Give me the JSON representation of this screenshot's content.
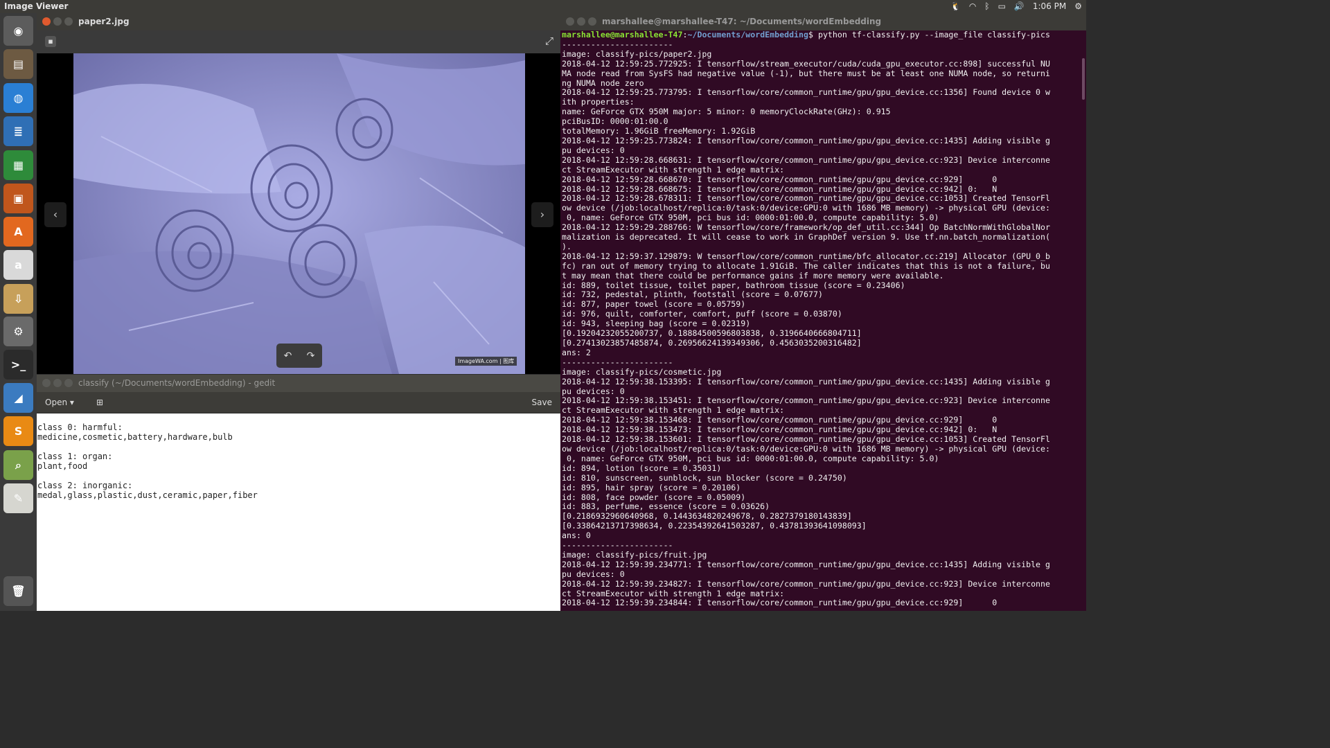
{
  "topbar": {
    "title": "Image Viewer",
    "clock": "1:06 PM"
  },
  "launcher": {
    "items": [
      {
        "name": "ubuntu-dash-icon",
        "glyph": "◉",
        "bg": "#5c5c5c"
      },
      {
        "name": "files-icon",
        "glyph": "▤",
        "bg": "#6d5a42"
      },
      {
        "name": "chrome-icon",
        "glyph": "◍",
        "bg": "#2a7fd4"
      },
      {
        "name": "writer-icon",
        "glyph": "≣",
        "bg": "#2f6fb5"
      },
      {
        "name": "calc-icon",
        "glyph": "▦",
        "bg": "#2e8b3a"
      },
      {
        "name": "impress-icon",
        "glyph": "▣",
        "bg": "#c0561c"
      },
      {
        "name": "software-center-icon",
        "glyph": "A",
        "bg": "#e2681f"
      },
      {
        "name": "amazon-icon",
        "glyph": "a",
        "bg": "#d9d9d9"
      },
      {
        "name": "archive-manager-icon",
        "glyph": "⇩",
        "bg": "#c7a05a"
      },
      {
        "name": "system-settings-icon",
        "glyph": "⚙",
        "bg": "#6a6a6a"
      },
      {
        "name": "terminal-icon",
        "glyph": ">_",
        "bg": "#2b2b2b"
      },
      {
        "name": "vmware-icon",
        "glyph": "◢",
        "bg": "#3b7bc0"
      },
      {
        "name": "sublime-text-icon",
        "glyph": "S",
        "bg": "#e98a14"
      },
      {
        "name": "image-viewer-icon",
        "glyph": "⌕",
        "bg": "#7aa14a"
      },
      {
        "name": "text-editor-icon",
        "glyph": "✎",
        "bg": "#d6d6d0"
      },
      {
        "name": "trash-icon",
        "glyph": "🗑",
        "bg": "#555"
      }
    ]
  },
  "image_viewer": {
    "title": "paper2.jpg",
    "watermark": "ImageWA.com | 图库"
  },
  "gedit": {
    "title": "classify (~/Documents/wordEmbedding) - gedit",
    "open_label": "Open",
    "save_label": "Save",
    "text": "class 0: harmful:\nmedicine,cosmetic,battery,hardware,bulb\n\nclass 1: organ:\nplant,food\n\nclass 2: inorganic:\nmedal,glass,plastic,dust,ceramic,paper,fiber"
  },
  "terminal": {
    "title": "marshallee@marshallee-T47: ~/Documents/wordEmbedding",
    "prompt_user": "marshallee@marshallee-T47",
    "prompt_path": "~/Documents/wordEmbedding",
    "prompt_cmd": "$ python tf-classify.py --image_file classify-pics",
    "output": "-----------------------\nimage: classify-pics/paper2.jpg\n2018-04-12 12:59:25.772925: I tensorflow/stream_executor/cuda/cuda_gpu_executor.cc:898] successful NU\nMA node read from SysFS had negative value (-1), but there must be at least one NUMA node, so returni\nng NUMA node zero\n2018-04-12 12:59:25.773795: I tensorflow/core/common_runtime/gpu/gpu_device.cc:1356] Found device 0 w\nith properties:\nname: GeForce GTX 950M major: 5 minor: 0 memoryClockRate(GHz): 0.915\npciBusID: 0000:01:00.0\ntotalMemory: 1.96GiB freeMemory: 1.92GiB\n2018-04-12 12:59:25.773824: I tensorflow/core/common_runtime/gpu/gpu_device.cc:1435] Adding visible g\npu devices: 0\n2018-04-12 12:59:28.668631: I tensorflow/core/common_runtime/gpu/gpu_device.cc:923] Device interconne\nct StreamExecutor with strength 1 edge matrix:\n2018-04-12 12:59:28.668670: I tensorflow/core/common_runtime/gpu/gpu_device.cc:929]      0\n2018-04-12 12:59:28.668675: I tensorflow/core/common_runtime/gpu/gpu_device.cc:942] 0:   N\n2018-04-12 12:59:28.678311: I tensorflow/core/common_runtime/gpu/gpu_device.cc:1053] Created TensorFl\now device (/job:localhost/replica:0/task:0/device:GPU:0 with 1686 MB memory) -> physical GPU (device:\n 0, name: GeForce GTX 950M, pci bus id: 0000:01:00.0, compute capability: 5.0)\n2018-04-12 12:59:29.288766: W tensorflow/core/framework/op_def_util.cc:344] Op BatchNormWithGlobalNor\nmalization is deprecated. It will cease to work in GraphDef version 9. Use tf.nn.batch_normalization(\n).\n2018-04-12 12:59:37.129879: W tensorflow/core/common_runtime/bfc_allocator.cc:219] Allocator (GPU_0_b\nfc) ran out of memory trying to allocate 1.91GiB. The caller indicates that this is not a failure, bu\nt may mean that there could be performance gains if more memory were available.\nid: 889, toilet tissue, toilet paper, bathroom tissue (score = 0.23406)\nid: 732, pedestal, plinth, footstall (score = 0.07677)\nid: 877, paper towel (score = 0.05759)\nid: 976, quilt, comforter, comfort, puff (score = 0.03870)\nid: 943, sleeping bag (score = 0.02319)\n[0.19204232055200737, 0.18884500596803838, 0.3196640666804711]\n[0.27413023857485874, 0.26956624139349306, 0.4563035200316482]\nans: 2\n-----------------------\nimage: classify-pics/cosmetic.jpg\n2018-04-12 12:59:38.153395: I tensorflow/core/common_runtime/gpu/gpu_device.cc:1435] Adding visible g\npu devices: 0\n2018-04-12 12:59:38.153451: I tensorflow/core/common_runtime/gpu/gpu_device.cc:923] Device interconne\nct StreamExecutor with strength 1 edge matrix:\n2018-04-12 12:59:38.153468: I tensorflow/core/common_runtime/gpu/gpu_device.cc:929]      0\n2018-04-12 12:59:38.153473: I tensorflow/core/common_runtime/gpu/gpu_device.cc:942] 0:   N\n2018-04-12 12:59:38.153601: I tensorflow/core/common_runtime/gpu/gpu_device.cc:1053] Created TensorFl\now device (/job:localhost/replica:0/task:0/device:GPU:0 with 1686 MB memory) -> physical GPU (device:\n 0, name: GeForce GTX 950M, pci bus id: 0000:01:00.0, compute capability: 5.0)\nid: 894, lotion (score = 0.35031)\nid: 810, sunscreen, sunblock, sun blocker (score = 0.24750)\nid: 895, hair spray (score = 0.20106)\nid: 808, face powder (score = 0.05009)\nid: 883, perfume, essence (score = 0.03626)\n[0.2186932960640968, 0.1443634820249678, 0.2827379180143839]\n[0.33864213717398634, 0.22354392641503287, 0.43781393641098093]\nans: 0\n-----------------------\nimage: classify-pics/fruit.jpg\n2018-04-12 12:59:39.234771: I tensorflow/core/common_runtime/gpu/gpu_device.cc:1435] Adding visible g\npu devices: 0\n2018-04-12 12:59:39.234827: I tensorflow/core/common_runtime/gpu/gpu_device.cc:923] Device interconne\nct StreamExecutor with strength 1 edge matrix:\n2018-04-12 12:59:39.234844: I tensorflow/core/common_runtime/gpu/gpu_device.cc:929]      0"
  }
}
